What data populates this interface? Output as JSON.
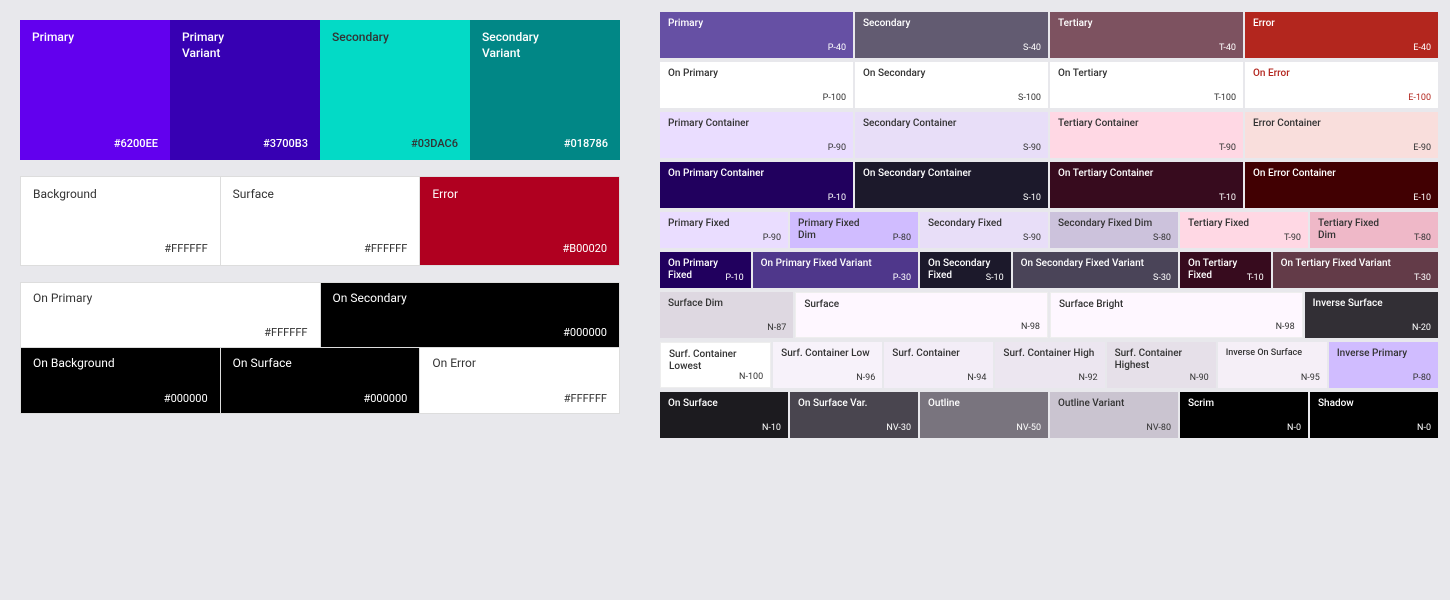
{
  "left": {
    "row1": [
      {
        "label": "Primary",
        "hex": "#6200EE",
        "bg": "#6200EE",
        "textColor": "white"
      },
      {
        "label": "Primary\nVariant",
        "hex": "#3700B3",
        "bg": "#3700B3",
        "textColor": "white"
      },
      {
        "label": "Secondary",
        "hex": "#03DAC6",
        "bg": "#03DAC6",
        "textColor": "#333"
      },
      {
        "label": "Secondary\nVariant",
        "hex": "#018786",
        "bg": "#018786",
        "textColor": "white"
      }
    ],
    "row2": [
      {
        "label": "Background",
        "hex": "#FFFFFF",
        "bg": "#FFFFFF"
      },
      {
        "label": "Surface",
        "hex": "#FFFFFF",
        "bg": "#FFFFFF"
      },
      {
        "label": "Error",
        "hex": "#B00020",
        "bg": "#B00020",
        "textColor": "white"
      }
    ],
    "row3_top": [
      {
        "label": "On Primary",
        "hex": "#FFFFFF",
        "bg": "#FFFFFF"
      },
      {
        "label": "On Secondary",
        "hex": "#000000",
        "bg": "#000000",
        "textColor": "white",
        "dark": true
      }
    ],
    "row3_bottom": [
      {
        "label": "On Background",
        "hex": "#000000",
        "bg": "#000000",
        "textColor": "white",
        "dark": true
      },
      {
        "label": "On Surface",
        "hex": "#000000",
        "bg": "#000000",
        "textColor": "white",
        "dark": true
      },
      {
        "label": "On Error",
        "hex": "#FFFFFF",
        "bg": "#FFFFFF"
      }
    ]
  },
  "right": {
    "row1": [
      {
        "label": "Primary",
        "code": "P-40",
        "class": "c-primary"
      },
      {
        "label": "Secondary",
        "code": "S-40",
        "class": "c-secondary"
      },
      {
        "label": "Tertiary",
        "code": "T-40",
        "class": "c-tertiary"
      },
      {
        "label": "Error",
        "code": "E-40",
        "class": "c-error"
      }
    ],
    "row2": [
      {
        "label": "On Primary",
        "code": "P-100",
        "class": "c-on-primary"
      },
      {
        "label": "On Secondary",
        "code": "S-100",
        "class": "c-on-secondary"
      },
      {
        "label": "On Tertiary",
        "code": "T-100",
        "class": "c-on-tertiary"
      },
      {
        "label": "On Error",
        "code": "E-100",
        "class": "c-on-error"
      }
    ],
    "row3": [
      {
        "label": "Primary Container",
        "code": "P-90",
        "class": "c-primary-container"
      },
      {
        "label": "Secondary Container",
        "code": "S-90",
        "class": "c-secondary-container"
      },
      {
        "label": "Tertiary Container",
        "code": "T-90",
        "class": "c-tertiary-container"
      },
      {
        "label": "Error Container",
        "code": "E-90",
        "class": "c-error-container"
      }
    ],
    "row4": [
      {
        "label": "On Primary Container",
        "code": "P-10",
        "class": "c-on-primary-container"
      },
      {
        "label": "On Secondary Container",
        "code": "S-10",
        "class": "c-on-secondary-container"
      },
      {
        "label": "On Tertiary Container",
        "code": "T-10",
        "class": "c-on-tertiary-container"
      },
      {
        "label": "On Error Container",
        "code": "E-10",
        "class": "c-on-error-container"
      }
    ],
    "row5a": [
      {
        "label": "Primary Fixed",
        "code": "P-90",
        "class": "c-primary-fixed"
      },
      {
        "label": "Primary Fixed Dim",
        "code": "P-80",
        "class": "c-primary-fixed-dim"
      },
      {
        "label": "Secondary Fixed",
        "code": "S-90",
        "class": "c-secondary-fixed"
      },
      {
        "label": "Secondary Fixed Dim",
        "code": "S-80",
        "class": "c-secondary-fixed-dim"
      },
      {
        "label": "Tertiary Fixed",
        "code": "T-90",
        "class": "c-tertiary-fixed"
      },
      {
        "label": "Tertiary Fixed Dim",
        "code": "T-80",
        "class": "c-tertiary-fixed-dim"
      }
    ],
    "row5b": [
      {
        "label": "On Primary Fixed",
        "code": "P-10",
        "class": "c-on-primary-fixed"
      },
      {
        "label": "On Secondary Fixed",
        "code": "S-10",
        "class": "c-on-secondary-fixed"
      },
      {
        "label": "On Tertiary Fixed",
        "code": "T-10",
        "class": "c-on-tertiary-fixed"
      }
    ],
    "row5c": [
      {
        "label": "On Primary Fixed Variant",
        "code": "P-30",
        "class": "c-on-primary-fixed-variant"
      },
      {
        "label": "On Secondary Fixed Variant",
        "code": "S-30",
        "class": "c-on-secondary-fixed-variant"
      },
      {
        "label": "On Tertiary Fixed Variant",
        "code": "T-30",
        "class": "c-on-tertiary-fixed-variant"
      }
    ],
    "row6": [
      {
        "label": "Surface Dim",
        "code": "N-87",
        "class": "c-surface-dim"
      },
      {
        "label": "Surface",
        "code": "N-98",
        "class": "c-surface"
      },
      {
        "label": "Surface Bright",
        "code": "N-98",
        "class": "c-surface-bright"
      },
      {
        "label": "Inverse Surface",
        "code": "N-20",
        "class": "c-inverse-surface"
      }
    ],
    "row7": [
      {
        "label": "Surf. Container Lowest",
        "code": "N-100",
        "class": "c-surf-container-lowest"
      },
      {
        "label": "Surf. Container Low",
        "code": "N-96",
        "class": "c-surf-container-low"
      },
      {
        "label": "Surf. Container",
        "code": "N-94",
        "class": "c-surf-container"
      },
      {
        "label": "Surf. Container High",
        "code": "N-92",
        "class": "c-surf-container-high"
      },
      {
        "label": "Surf. Container Highest",
        "code": "N-90",
        "class": "c-surf-container-highest"
      },
      {
        "label": "Inverse On Surface",
        "code": "N-95",
        "class": "c-inverse-on-surface"
      },
      {
        "label": "Inverse Primary",
        "code": "P-80",
        "class": "c-inverse-primary"
      }
    ],
    "row8": [
      {
        "label": "On Surface",
        "code": "N-10",
        "class": "c-on-surface"
      },
      {
        "label": "On Surface Var.",
        "code": "NV-30",
        "class": "c-on-surface-variant"
      },
      {
        "label": "Outline",
        "code": "NV-50",
        "class": "c-outline"
      },
      {
        "label": "Outline Variant",
        "code": "NV-80",
        "class": "c-outline-variant"
      },
      {
        "label": "Scrim",
        "code": "N-0",
        "class": "c-scrim"
      },
      {
        "label": "Shadow",
        "code": "N-0",
        "class": "c-shadow"
      }
    ]
  }
}
